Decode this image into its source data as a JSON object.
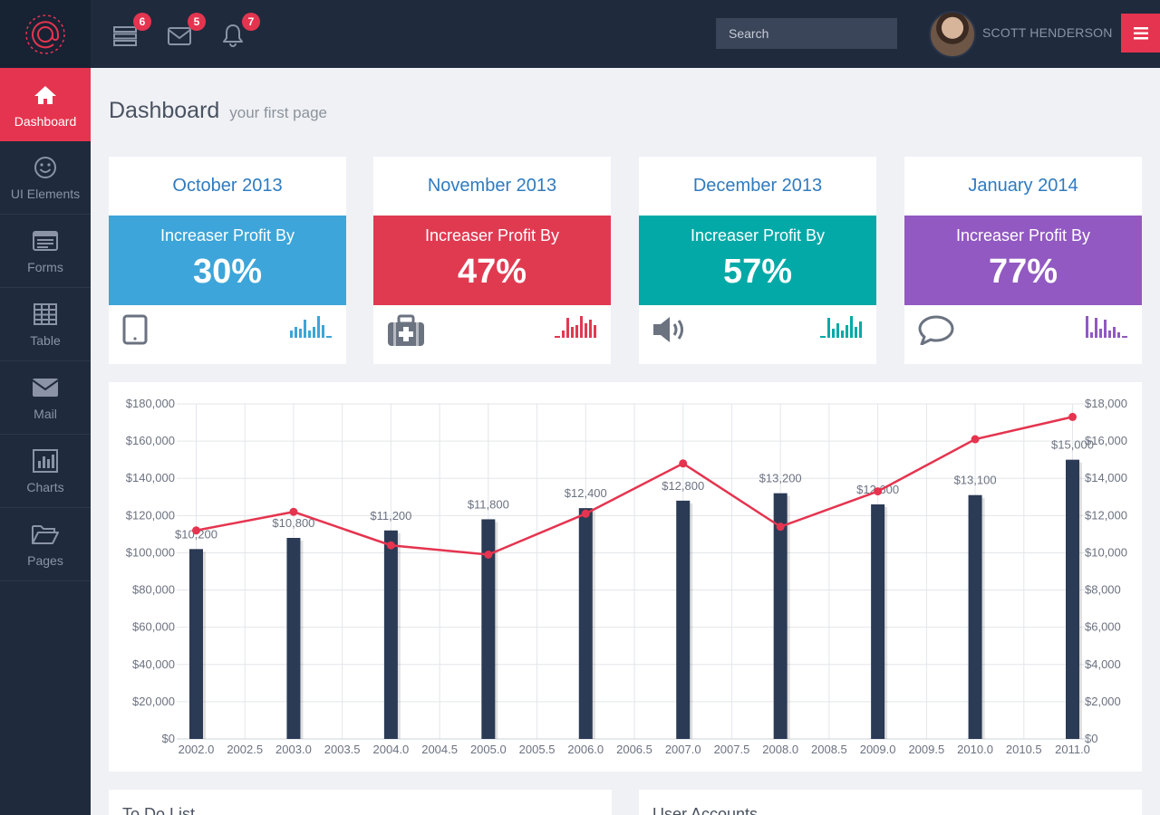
{
  "header": {
    "badges": {
      "server": "6",
      "mail": "5",
      "bell": "7"
    },
    "search_placeholder": "Search",
    "username": "SCOTT HENDERSON"
  },
  "sidebar": {
    "items": [
      {
        "label": "Dashboard",
        "icon": "home-icon"
      },
      {
        "label": "UI Elements",
        "icon": "smiley-icon"
      },
      {
        "label": "Forms",
        "icon": "form-icon"
      },
      {
        "label": "Table",
        "icon": "table-icon"
      },
      {
        "label": "Mail",
        "icon": "mail-icon"
      },
      {
        "label": "Charts",
        "icon": "bar-chart-icon"
      },
      {
        "label": "Pages",
        "icon": "folder-icon"
      }
    ]
  },
  "page": {
    "title": "Dashboard",
    "subtitle": "your first page"
  },
  "cards": [
    {
      "month": "October 2013",
      "label": "Increaser Profit By",
      "value": "30%",
      "color": "#3da5d9",
      "icon": "tablet-icon"
    },
    {
      "month": "November 2013",
      "label": "Increaser Profit By",
      "value": "47%",
      "color": "#e03a51",
      "icon": "medkit-icon"
    },
    {
      "month": "December 2013",
      "label": "Increaser Profit By",
      "value": "57%",
      "color": "#03a9a7",
      "icon": "volume-icon"
    },
    {
      "month": "January 2014",
      "label": "Increaser Profit By",
      "value": "77%",
      "color": "#9159c1",
      "icon": "comment-icon"
    }
  ],
  "panels": {
    "todo_title": "To Do List",
    "accounts_title": "User Accounts"
  },
  "colors": {
    "accent": "#e5344f",
    "bar": "#2b3a55",
    "line": "#e5344f",
    "sidebar": "#1f2a3d"
  },
  "chart_data": {
    "type": "bar",
    "x": [
      2002,
      2003,
      2004,
      2005,
      2006,
      2007,
      2008,
      2009,
      2010,
      2011
    ],
    "x_tick_labels": [
      "2002.0",
      "2002.5",
      "2003.0",
      "2003.5",
      "2004.0",
      "2004.5",
      "2005.0",
      "2005.5",
      "2006.0",
      "2006.5",
      "2007.0",
      "2007.5",
      "2008.0",
      "2008.5",
      "2009.0",
      "2009.5",
      "2010.0",
      "2010.5",
      "2011.0"
    ],
    "xlim": [
      2001.8,
      2011.2
    ],
    "series": [
      {
        "axis": "left",
        "type": "bar",
        "values": [
          102000,
          108000,
          112000,
          118000,
          124000,
          128000,
          132000,
          126000,
          131000,
          150000
        ],
        "data_labels": [
          "$10,200",
          "$10,800",
          "$11,200",
          "$11,800",
          "$12,400",
          "$12,800",
          "$13,200",
          "$12,600",
          "$13,100",
          "$15,000"
        ]
      },
      {
        "axis": "right",
        "type": "line",
        "values": [
          11200,
          12200,
          10400,
          9900,
          12100,
          14800,
          11400,
          13300,
          16100,
          17300
        ]
      }
    ],
    "y_left": {
      "ylim": [
        0,
        180000
      ],
      "ticks": [
        "$0",
        "$20,000",
        "$40,000",
        "$60,000",
        "$80,000",
        "$100,000",
        "$120,000",
        "$140,000",
        "$160,000",
        "$180,000"
      ]
    },
    "y_right": {
      "ylim": [
        0,
        18000
      ],
      "ticks": [
        "$0",
        "$2,000",
        "$4,000",
        "$6,000",
        "$8,000",
        "$10,000",
        "$12,000",
        "$14,000",
        "$16,000",
        "$18,000"
      ]
    },
    "grid": true
  }
}
